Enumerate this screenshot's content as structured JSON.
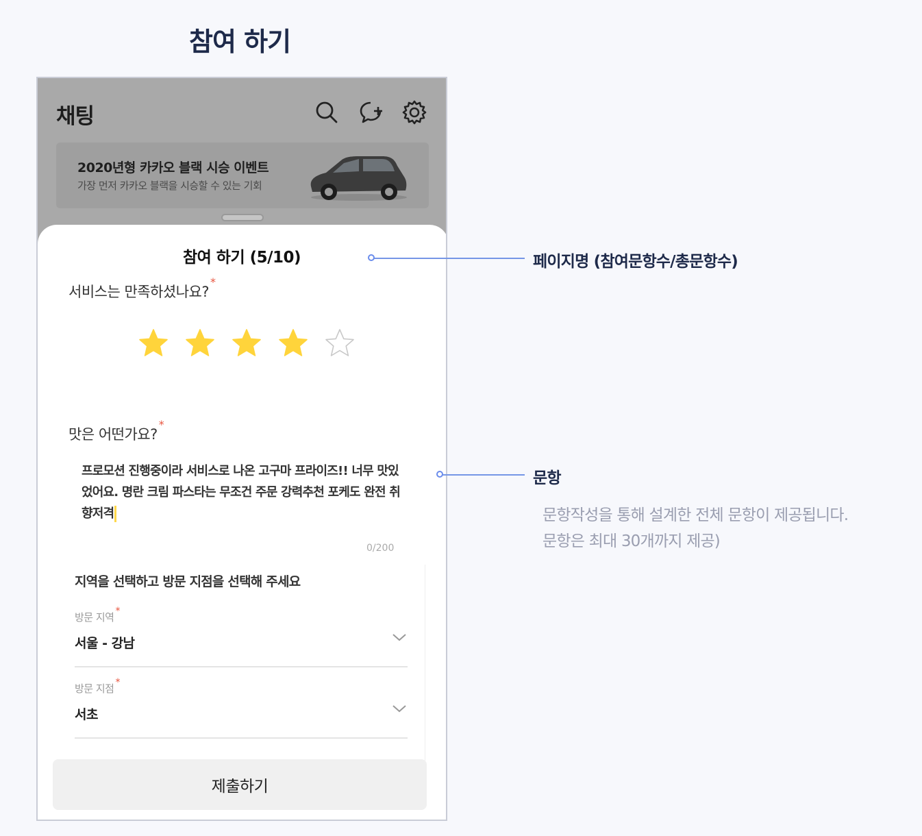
{
  "page_heading": "참여 하기",
  "app": {
    "title": "채팅",
    "icons": [
      "search-icon",
      "new-chat-icon",
      "settings-icon"
    ]
  },
  "banner": {
    "title": "2020년형 카카오 블랙 시승 이벤트",
    "subtitle": "가장 먼저 카카오 블랙을 시승할 수 있는 기회"
  },
  "sheet": {
    "title": "참여 하기 (5/10)",
    "q1": {
      "label": "서비스는 만족하셨나요?",
      "required": "*",
      "rating": 4,
      "max": 5
    },
    "q2": {
      "label": "맛은 어떤가요?",
      "required": "*",
      "answer": "프로모션 진행중이라 서비스로 나온 고구마 프라이즈!! 너무 맛있었어요. 명란 크림 파스타는 무조건 주문 강력추천 포케도 완전 취향저격",
      "counter": "0/200"
    },
    "q3": {
      "title": "지역을 선택하고 방문 지점을 선택해 주세요",
      "region_label": "방문 지역",
      "region_value": "서울 - 강남",
      "branch_label": "방문 지점",
      "branch_value": "서초",
      "required": "*"
    },
    "submit_label": "제출하기"
  },
  "callouts": {
    "page_name": {
      "title": "페이지명 (참여문항수/총문항수)"
    },
    "questions": {
      "title": "문항",
      "desc_line1": "문항작성을 통해 설계한 전체 문항이 제공됩니다.",
      "desc_line2": "문항은 최대 30개까지 제공)"
    }
  },
  "colors": {
    "accent_line": "#7596e6",
    "star": "#ffd43b",
    "required": "#e8553f"
  }
}
